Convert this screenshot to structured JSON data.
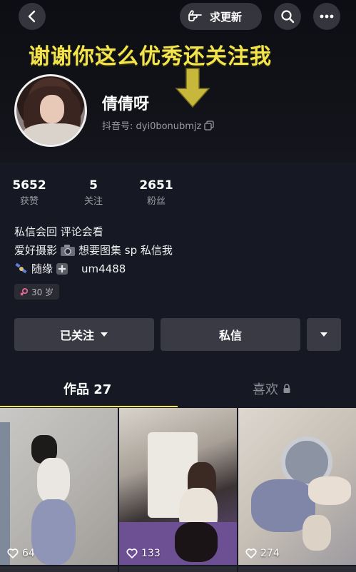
{
  "header": {
    "update_label": "求更新",
    "banner_text": "谢谢你这么优秀还关注我",
    "nickname": "倩倩呀",
    "douyin_id": "抖音号: dyi0bonubmjz"
  },
  "stats": [
    {
      "value": "5652",
      "label": "获赞"
    },
    {
      "value": "5",
      "label": "关注"
    },
    {
      "value": "2651",
      "label": "粉丝"
    }
  ],
  "bio": {
    "line1": "私信会回 评论会看",
    "line2a": "爱好摄影",
    "line2b": "想要图集 sp 私信我",
    "line3a": "随缘",
    "line3b": "um4488"
  },
  "tag": {
    "age": "30 岁"
  },
  "actions": {
    "follow_label": "已关注",
    "message_label": "私信"
  },
  "tabs": {
    "works_label": "作品 27",
    "likes_label": "喜欢"
  },
  "videos": [
    {
      "likes": "64"
    },
    {
      "likes": "133"
    },
    {
      "likes": "274"
    }
  ],
  "colors": {
    "accent": "#f3e44c",
    "background": "#161823",
    "button": "#393a43"
  }
}
